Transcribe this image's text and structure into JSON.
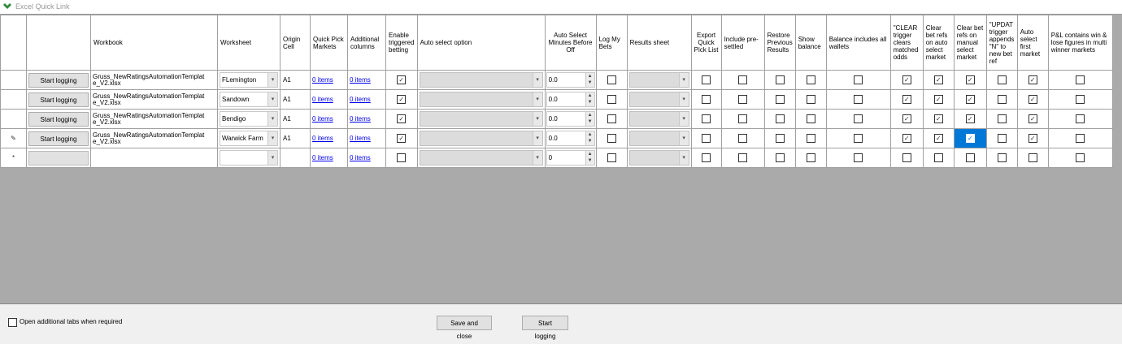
{
  "window": {
    "title": "Excel Quick Link",
    "icon": "excel-link-icon"
  },
  "columns": [
    "",
    "",
    "Workbook",
    "Worksheet",
    "Origin Cell",
    "Quick Pick Markets",
    "Additional columns",
    "Enable triggered betting",
    "Auto select option",
    "Auto Select Minutes Before Off",
    "Log My Bets",
    "Results sheet",
    "Export Quick Pick List",
    "Include pre-settled",
    "Restore Previous Results",
    "Show balance",
    "Balance includes all wallets",
    "\"CLEAR trigger clears matched odds",
    "Clear bet refs on auto select market",
    "Clear bet refs on manual select market",
    "\"UPDAT trigger appends \"N\" to new bet ref",
    "Auto select first market",
    "P&L contains win & lose figures in multi winner markets"
  ],
  "rows": [
    {
      "marker": "",
      "button": "Start logging",
      "workbook": "Gruss_NewRatingsAutomationTemplat\ne_V2.xlsx",
      "worksheet": "FLemington",
      "origin": "A1",
      "qpm": "0 items",
      "addcols": "0 items",
      "enable_trig": true,
      "auto_select": "",
      "minutes": "0.0",
      "log_bets": false,
      "results": "",
      "flags": [
        false,
        false,
        false,
        false,
        false,
        true,
        true,
        true,
        false,
        true,
        false
      ]
    },
    {
      "marker": "",
      "button": "Start logging",
      "workbook": "Gruss_NewRatingsAutomationTemplat\ne_V2.xlsx",
      "worksheet": "Sandown",
      "origin": "A1",
      "qpm": "0 items",
      "addcols": "0 items",
      "enable_trig": true,
      "auto_select": "",
      "minutes": "0.0",
      "log_bets": false,
      "results": "",
      "flags": [
        false,
        false,
        false,
        false,
        false,
        true,
        true,
        true,
        false,
        true,
        false
      ]
    },
    {
      "marker": "",
      "button": "Start logging",
      "workbook": "Gruss_NewRatingsAutomationTemplat\ne_V2.xlsx",
      "worksheet": "Bendigo",
      "origin": "A1",
      "qpm": "0 items",
      "addcols": "0 items",
      "enable_trig": true,
      "auto_select": "",
      "minutes": "0.0",
      "log_bets": false,
      "results": "",
      "flags": [
        false,
        false,
        false,
        false,
        false,
        true,
        true,
        true,
        false,
        true,
        false
      ]
    },
    {
      "marker": "✎",
      "button": "Start logging",
      "workbook": "Gruss_NewRatingsAutomationTemplat\ne_V2.xlsx",
      "worksheet": "Warwick Farm",
      "origin": "A1",
      "qpm": "0 items",
      "addcols": "0 items",
      "enable_trig": true,
      "auto_select": "",
      "minutes": "0.0",
      "log_bets": false,
      "results": "",
      "flags": [
        false,
        false,
        false,
        false,
        false,
        true,
        true,
        true,
        false,
        true,
        false
      ]
    },
    {
      "marker": "*",
      "button": "",
      "workbook": "",
      "worksheet": "",
      "origin": "",
      "qpm": "0 items",
      "addcols": "0 items",
      "enable_trig": false,
      "auto_select": "",
      "minutes": "0",
      "log_bets": false,
      "results": "",
      "flags": [
        false,
        false,
        false,
        false,
        false,
        false,
        false,
        false,
        false,
        false,
        false
      ]
    }
  ],
  "footer": {
    "open_tabs_label": "Open additional tabs when required",
    "open_tabs_checked": false,
    "save_close_label": "Save and close",
    "start_logging_label": "Start logging"
  },
  "colors": {
    "selection": "#0078d7",
    "grid_bg": "#aaaaaa",
    "link": "#0000ee"
  }
}
